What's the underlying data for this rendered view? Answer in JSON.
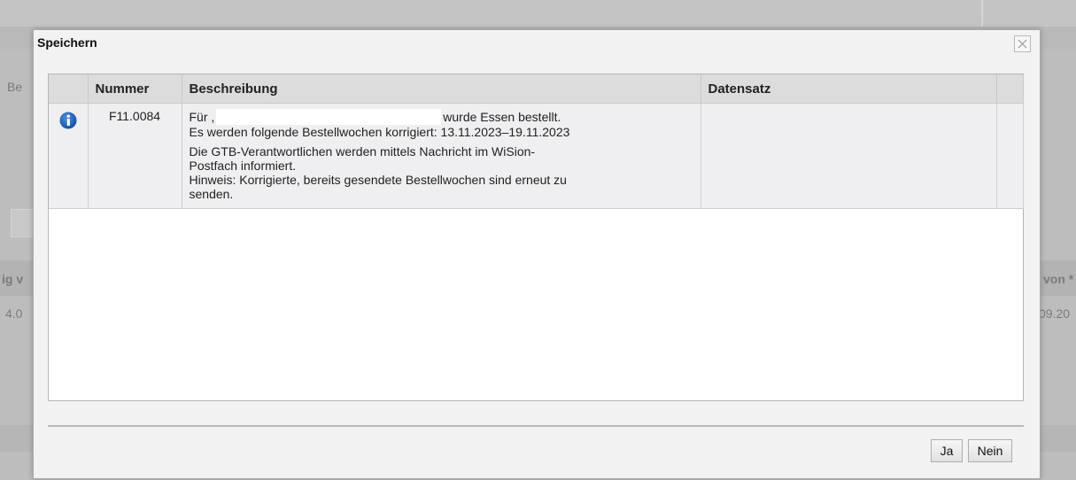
{
  "background": {
    "fragments": [
      "Be",
      "ig v",
      "4.0",
      "von *",
      "09.20"
    ]
  },
  "dialog": {
    "title": "Speichern",
    "close_label": "",
    "table": {
      "columns": [
        "",
        "Nummer",
        "Beschreibung",
        "Datensatz",
        ""
      ],
      "rows": [
        {
          "icon": "info-icon",
          "nummer": "F11.0084",
          "line1_prefix": "Für ,",
          "line1_suffix": "wurde Essen bestellt.",
          "line2": "Es werden folgende Bestellwochen korrigiert: 13.11.2023–19.11.2023",
          "para2_line1": "Die GTB-Verantwortlichen werden mittels Nachricht im WiSion-",
          "para2_line2": "Postfach informiert.",
          "para2_line3": "Hinweis: Korrigierte, bereits gesendete Bestellwochen sind erneut zu",
          "para2_line4": "senden.",
          "datensatz": ""
        }
      ]
    },
    "buttons": {
      "ja": "Ja",
      "nein": "Nein"
    }
  },
  "colors": {
    "info_icon": "#1b5fb7",
    "header_bg": "#dcdcdc",
    "row_bg": "#efeef0"
  }
}
